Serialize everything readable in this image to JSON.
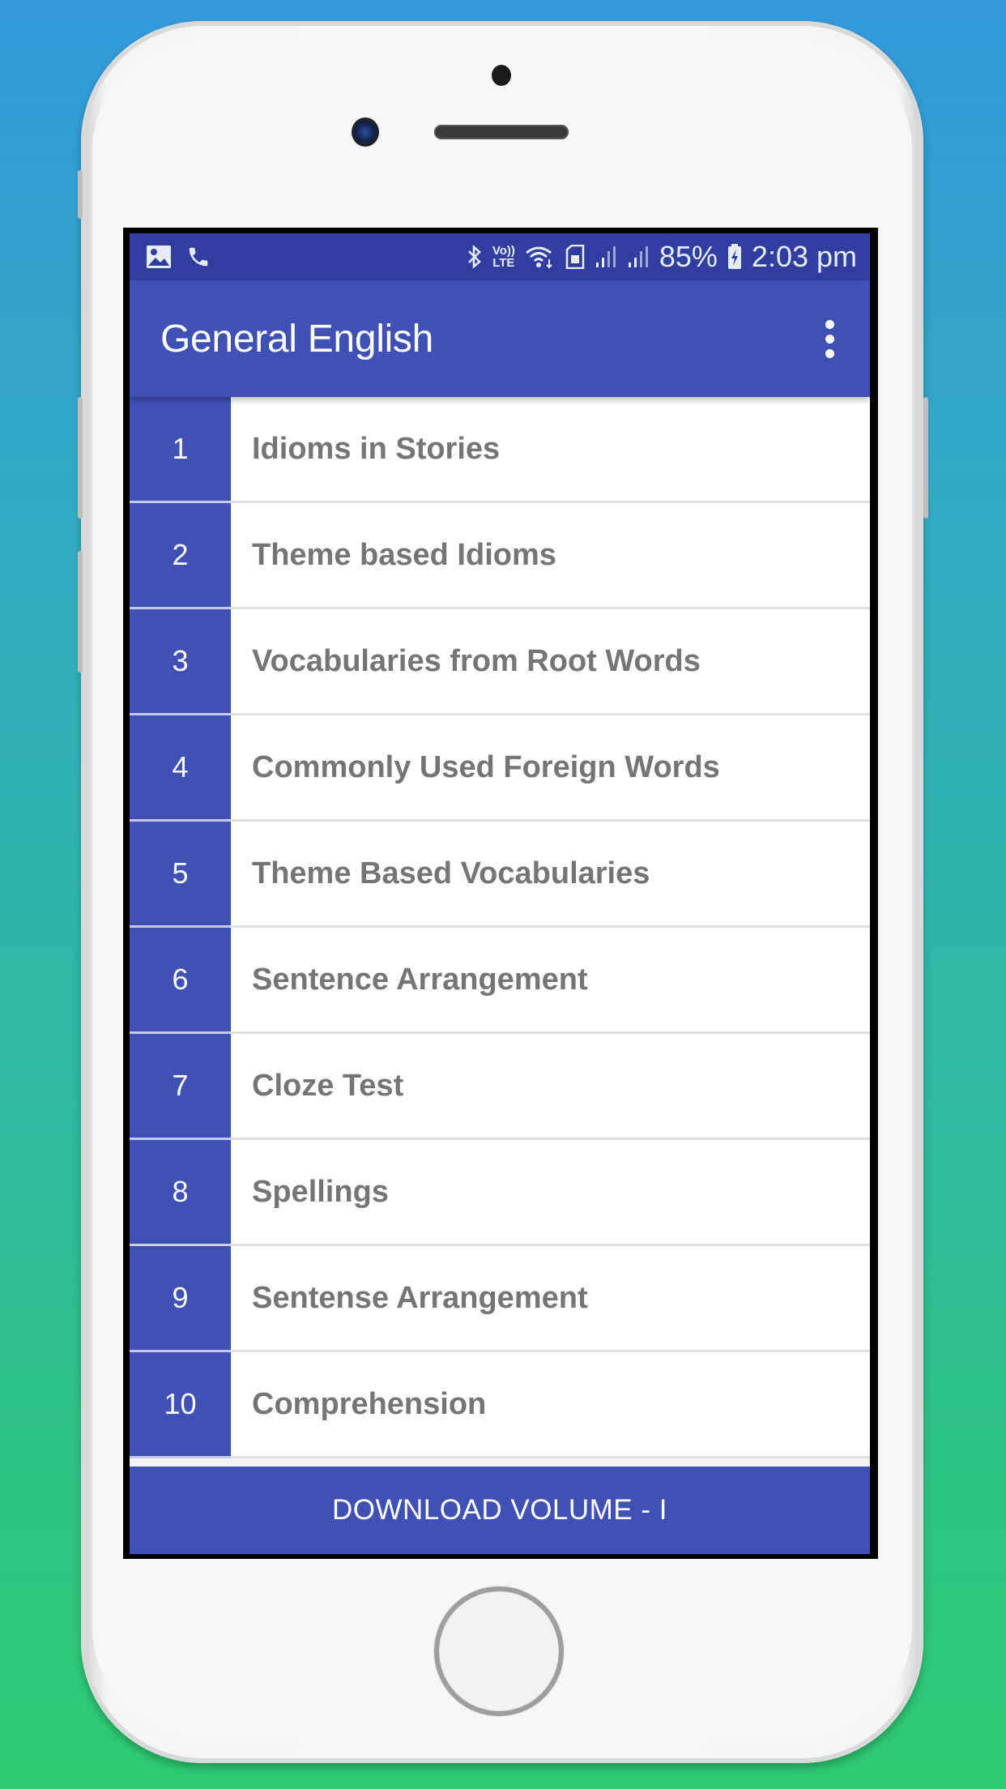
{
  "colors": {
    "primary": "#3F51B5",
    "primary_dark": "#303F9F",
    "item_text": "#757575",
    "divider": "#E0E0E0"
  },
  "statusbar": {
    "left_icons": [
      "image-icon",
      "phone-icon"
    ],
    "right_icons": [
      "bluetooth-icon",
      "volte-icon",
      "wifi-icon",
      "sim-icon",
      "signal-icon",
      "signal-icon"
    ],
    "volte_top": "Vo))",
    "volte_bottom": "LTE",
    "battery_percent": "85%",
    "time": "2:03 pm"
  },
  "appbar": {
    "title": "General English",
    "menu_icon": "more-vert-icon"
  },
  "list": {
    "items": [
      {
        "number": "1",
        "label": "Idioms in Stories"
      },
      {
        "number": "2",
        "label": "Theme based Idioms"
      },
      {
        "number": "3",
        "label": "Vocabularies from Root Words"
      },
      {
        "number": "4",
        "label": "Commonly Used Foreign Words"
      },
      {
        "number": "5",
        "label": "Theme Based Vocabularies"
      },
      {
        "number": "6",
        "label": "Sentence Arrangement"
      },
      {
        "number": "7",
        "label": "Cloze Test"
      },
      {
        "number": "8",
        "label": "Spellings"
      },
      {
        "number": "9",
        "label": "Sentense Arrangement"
      },
      {
        "number": "10",
        "label": "Comprehension"
      }
    ]
  },
  "footer": {
    "download_label": "DOWNLOAD VOLUME - I"
  }
}
